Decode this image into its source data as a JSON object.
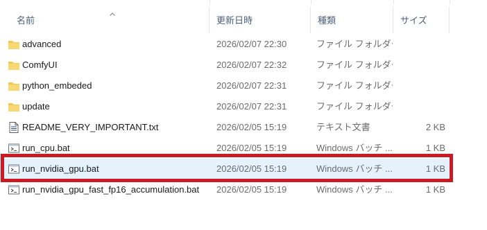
{
  "columns": {
    "name": "名前",
    "date": "更新日時",
    "type": "種類",
    "size": "サイズ"
  },
  "rows": [
    {
      "icon": "folder-icon",
      "name": "advanced",
      "date": "2026/02/07 22:30",
      "type": "ファイル フォルダー",
      "size": ""
    },
    {
      "icon": "folder-icon",
      "name": "ComfyUI",
      "date": "2026/02/07 22:32",
      "type": "ファイル フォルダー",
      "size": ""
    },
    {
      "icon": "folder-icon",
      "name": "python_embeded",
      "date": "2026/02/07 22:31",
      "type": "ファイル フォルダー",
      "size": ""
    },
    {
      "icon": "folder-icon",
      "name": "update",
      "date": "2026/02/07 22:31",
      "type": "ファイル フォルダー",
      "size": ""
    },
    {
      "icon": "text-file-icon",
      "name": "README_VERY_IMPORTANT.txt",
      "date": "2026/02/05 15:19",
      "type": "テキスト文書",
      "size": "2 KB"
    },
    {
      "icon": "batch-file-icon",
      "name": "run_cpu.bat",
      "date": "2026/02/05 15:19",
      "type": "Windows バッチ ...",
      "size": "1 KB"
    },
    {
      "icon": "batch-file-icon",
      "name": "run_nvidia_gpu.bat",
      "date": "2026/02/05 15:19",
      "type": "Windows バッチ ...",
      "size": "1 KB"
    },
    {
      "icon": "batch-file-icon",
      "name": "run_nvidia_gpu_fast_fp16_accumulation.bat",
      "date": "2026/02/05 15:19",
      "type": "Windows バッチ ...",
      "size": "1 KB"
    }
  ],
  "selected_row": "run_nvidia_gpu.bat",
  "colors": {
    "highlight_border": "#cc1a24",
    "selected_bg": "#e5f1fb",
    "folder": "#f2c94c"
  }
}
